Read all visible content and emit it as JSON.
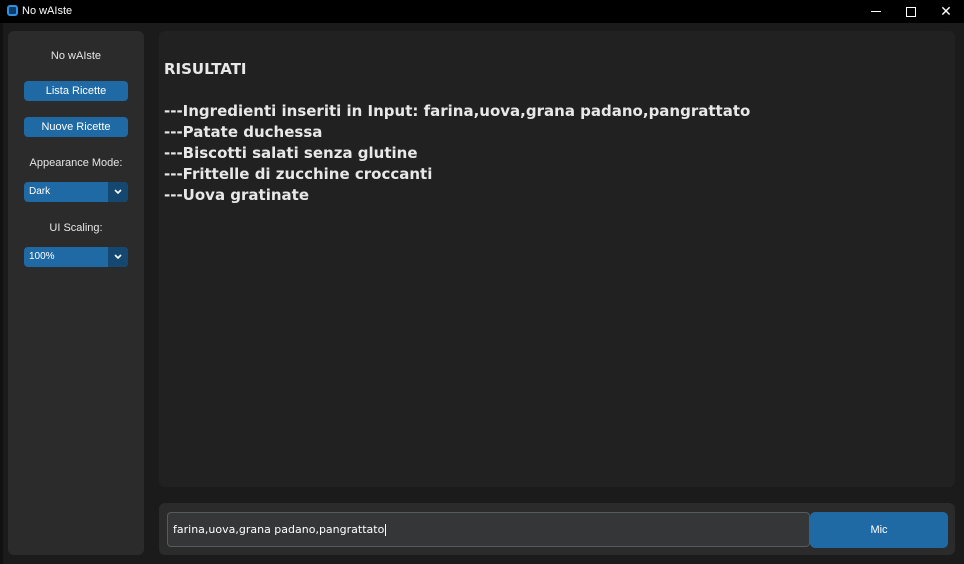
{
  "window": {
    "title": "No wAIste",
    "controls": {
      "minimize": "minimize-icon",
      "maximize": "maximize-icon",
      "close": "close-icon"
    }
  },
  "sidebar": {
    "title": "No wAIste",
    "buttons": [
      {
        "label": "Lista Ricette"
      },
      {
        "label": "Nuove Ricette"
      }
    ],
    "appearance": {
      "label": "Appearance Mode:",
      "value": "Dark"
    },
    "scaling": {
      "label": "UI Scaling:",
      "value": "100%"
    }
  },
  "results": {
    "heading": "RISULTATI",
    "lines": [
      "---Ingredienti inseriti in Input: farina,uova,grana padano,pangrattato",
      "---Patate duchessa",
      "---Biscotti salati senza glutine",
      "---Frittelle di zucchine croccanti",
      "---Uova gratinate"
    ]
  },
  "input": {
    "value": "farina,uova,grana padano,pangrattato"
  },
  "mic": {
    "label": "Mic"
  },
  "colors": {
    "accent": "#1f6aa5",
    "background": "#1b1b1b",
    "panel": "#2b2b2b",
    "textbox": "#212121"
  }
}
